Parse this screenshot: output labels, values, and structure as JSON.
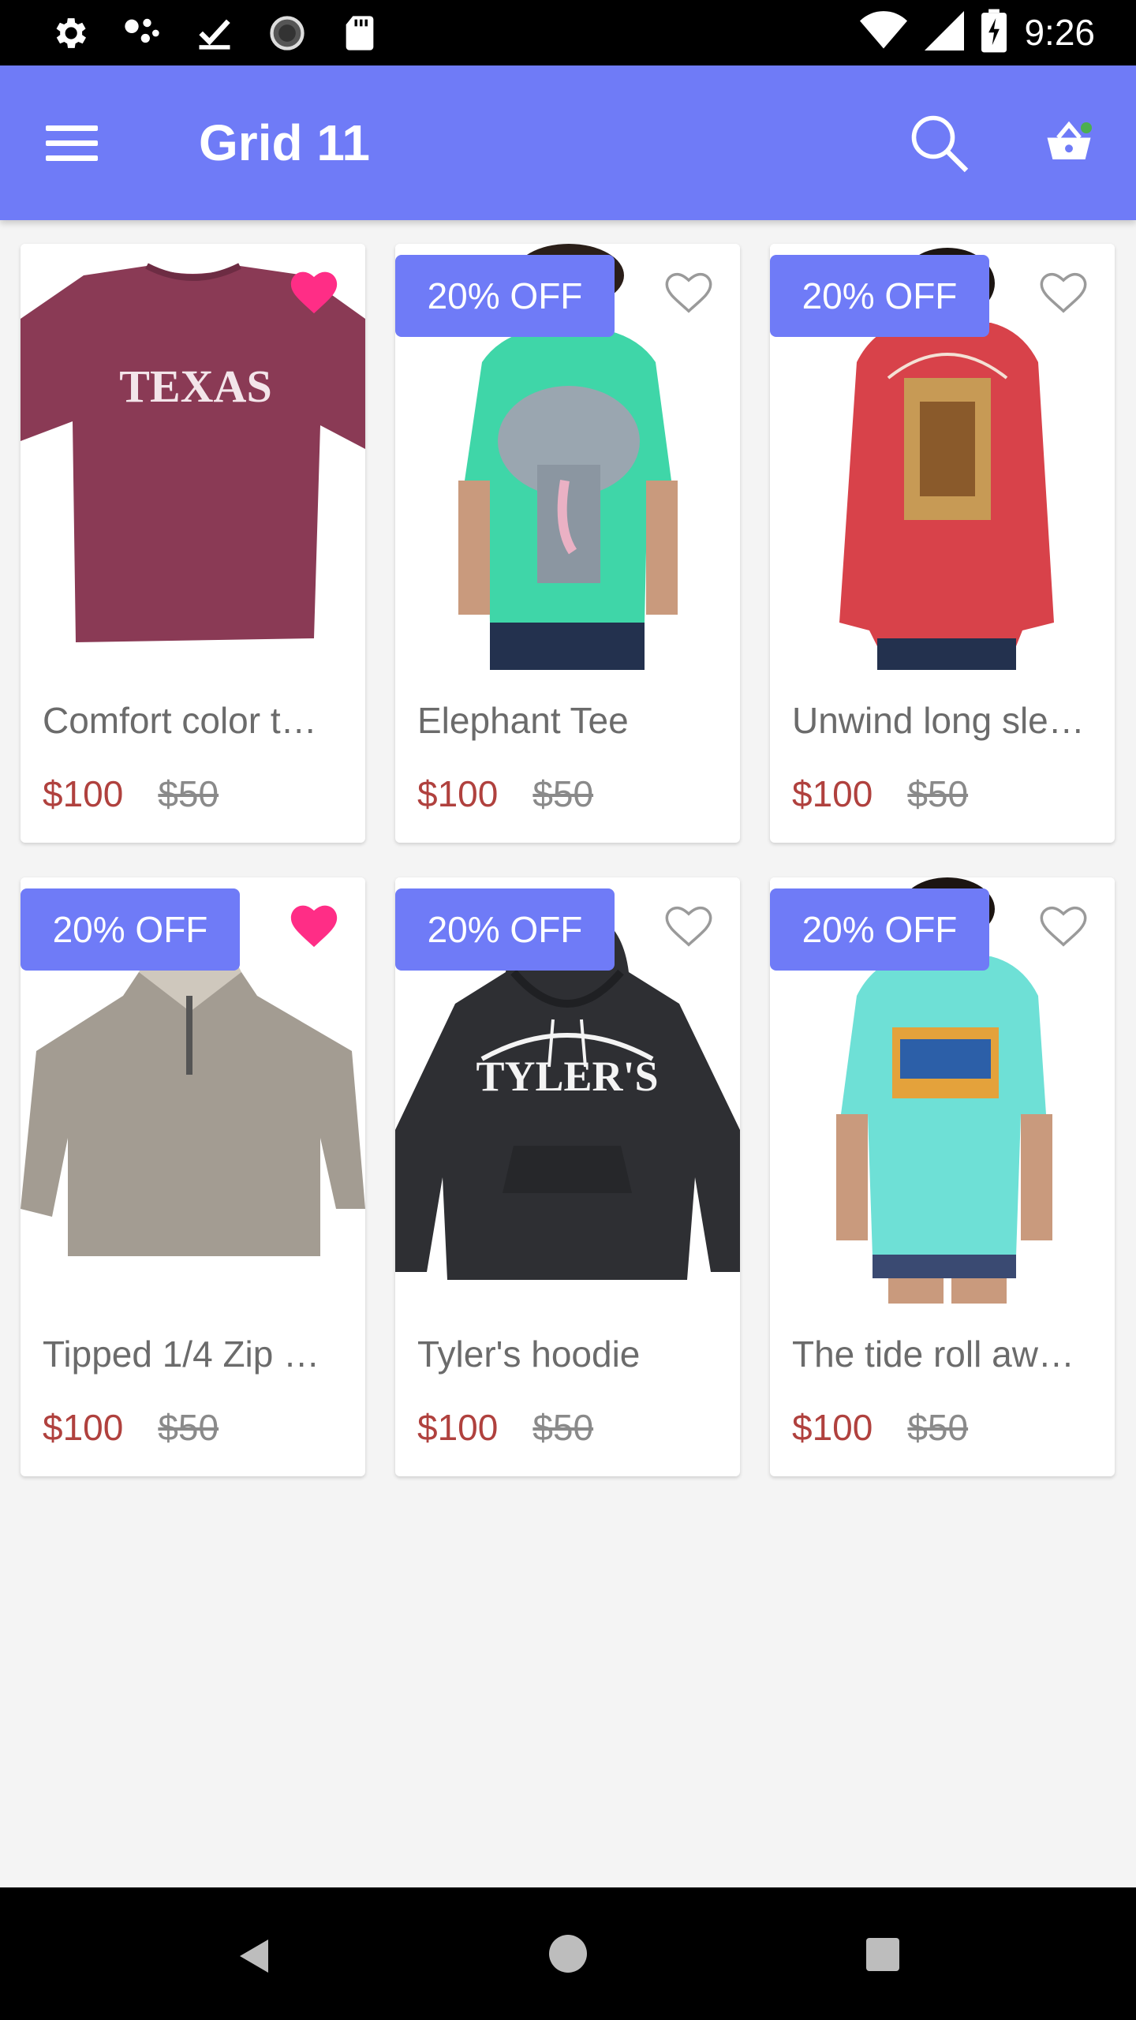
{
  "status_bar": {
    "time": "9:26",
    "left_icons": [
      "settings-icon",
      "assistant-dots-icon",
      "download-done-icon",
      "sync-icon",
      "sd-card-icon"
    ],
    "right_icons": [
      "wifi-icon",
      "signal-icon",
      "battery-charging-icon"
    ]
  },
  "app_bar": {
    "title": "Grid 11",
    "menu_icon": "menu-icon",
    "search_icon": "search-icon",
    "cart_icon": "basket-icon",
    "cart_badge_color": "#4caf50",
    "background_color": "#6f7bf7"
  },
  "products": [
    {
      "name": "Comfort color t…",
      "price": "$100",
      "old_price": "$50",
      "badge": "",
      "favorited": true,
      "shirt_color": "#8a3a55",
      "image_desc": "tshirt-texas"
    },
    {
      "name": "Elephant Tee",
      "price": "$100",
      "old_price": "$50",
      "badge": "20% OFF",
      "favorited": false,
      "shirt_color": "#3fd6a8",
      "image_desc": "tshirt-elephant"
    },
    {
      "name": "Unwind long sle…",
      "price": "$100",
      "old_price": "$50",
      "badge": "20% OFF",
      "favorited": false,
      "shirt_color": "#d8424a",
      "image_desc": "longsleeve-unwind"
    },
    {
      "name": "Tipped 1/4 Zip …",
      "price": "$100",
      "old_price": "$50",
      "badge": "20% OFF",
      "favorited": true,
      "shirt_color": "#a39c92",
      "image_desc": "zip-fleece"
    },
    {
      "name": "Tyler's hoodie",
      "price": "$100",
      "old_price": "$50",
      "badge": "20% OFF",
      "favorited": false,
      "shirt_color": "#2e2f33",
      "image_desc": "hoodie-tylers"
    },
    {
      "name": "The tide roll aw…",
      "price": "$100",
      "old_price": "$50",
      "badge": "20% OFF",
      "favorited": false,
      "shirt_color": "#6ee0d6",
      "image_desc": "tshirt-tide"
    }
  ],
  "colors": {
    "accent": "#6f7bf7",
    "price": "#b0413e",
    "favorite": "#ff2d86"
  },
  "image_text": {
    "texas": "TEXAS",
    "tylers": "TYLER'S"
  },
  "nav_bar": {
    "icons": [
      "back-icon",
      "home-icon",
      "recents-icon"
    ]
  }
}
